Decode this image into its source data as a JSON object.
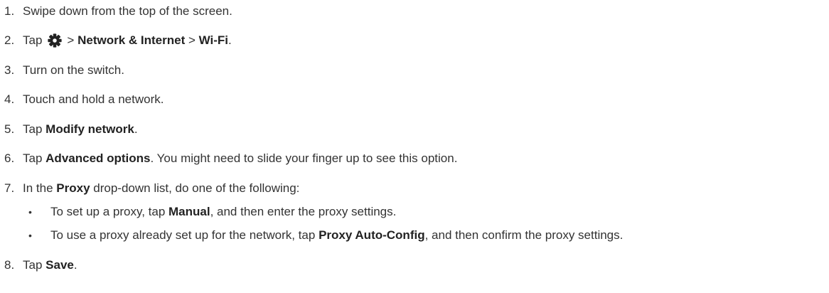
{
  "steps": [
    {
      "num": "1.",
      "text": "Swipe down from the top of the screen."
    },
    {
      "num": "2.",
      "tap": "Tap",
      "sep1": ">",
      "network": "Network & Internet",
      "sep2": ">",
      "wifi": "Wi-Fi",
      "end": "."
    },
    {
      "num": "3.",
      "text": "Turn on the switch."
    },
    {
      "num": "4.",
      "text": "Touch and hold a network."
    },
    {
      "num": "5.",
      "pre": "Tap ",
      "bold": "Modify network",
      "post": "."
    },
    {
      "num": "6.",
      "pre": "Tap ",
      "bold": "Advanced options",
      "post": ". You might need to slide your finger up to see this option."
    },
    {
      "num": "7.",
      "pre": "In the ",
      "bold": "Proxy",
      "post": " drop-down list, do one of the following:",
      "bullets": [
        {
          "pre": "To set up a proxy, tap ",
          "bold": "Manual",
          "post": ", and then enter the proxy settings."
        },
        {
          "pre": "To use a proxy already set up for the network, tap ",
          "bold": "Proxy Auto-Config",
          "post": ", and then confirm the proxy settings."
        }
      ]
    },
    {
      "num": "8.",
      "pre": "Tap ",
      "bold": "Save",
      "post": "."
    }
  ],
  "bullet_glyph": "•",
  "icons": {
    "settings": "gear-icon"
  },
  "colors": {
    "text": "#333333",
    "bold": "#222222"
  }
}
